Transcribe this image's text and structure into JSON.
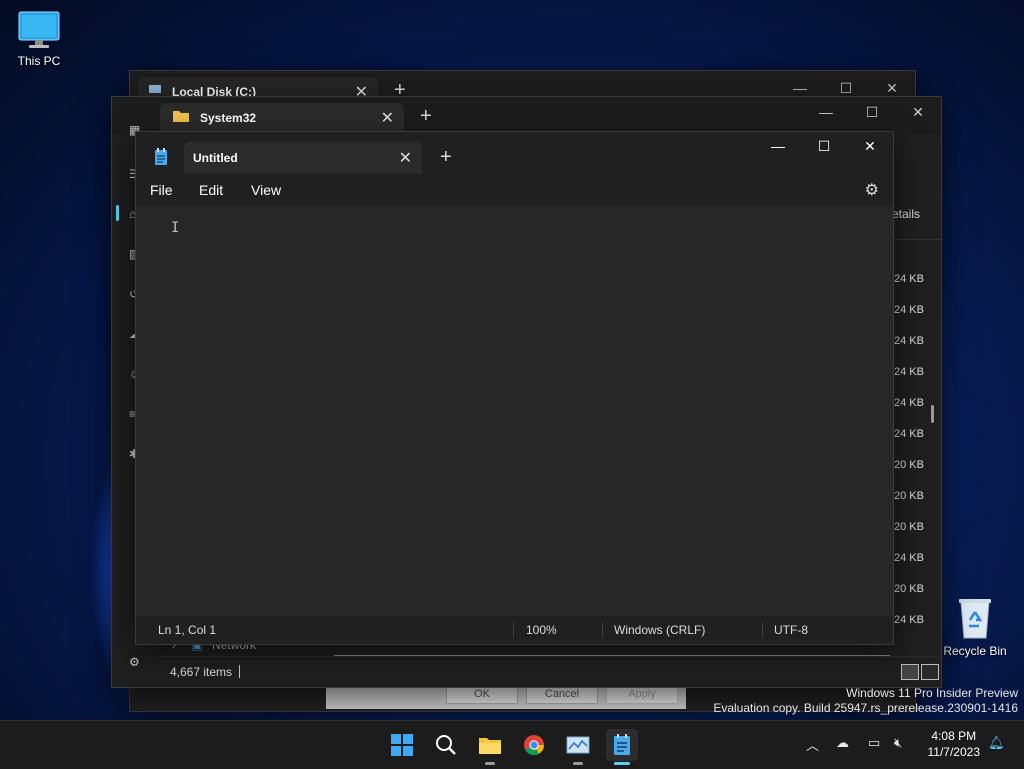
{
  "desktop": {
    "this_pc_label": "This PC",
    "recycle_bin_label": "Recycle Bin",
    "watermark_line1": "Windows 11 Pro Insider Preview",
    "watermark_line2": "Evaluation copy. Build 25947.rs_prerelease.230901-1416"
  },
  "explorer_back": {
    "tab_label": "Local Disk (C:)"
  },
  "explorer_front": {
    "tab_label": "System32",
    "details_label": "etails",
    "sizes": [
      "24 KB",
      "24 KB",
      "24 KB",
      "24 KB",
      "24 KB",
      "24 KB",
      "20 KB",
      "20 KB",
      "20 KB",
      "24 KB",
      "20 KB",
      "24 KB"
    ],
    "network_label": "Network",
    "items_count": "4,667 items",
    "dialog_ok": "OK",
    "dialog_cancel": "Cancel",
    "dialog_apply": "Apply"
  },
  "notepad": {
    "tab_label": "Untitled",
    "menu": {
      "file": "File",
      "edit": "Edit",
      "view": "View"
    },
    "status": {
      "position": "Ln 1, Col 1",
      "zoom": "100%",
      "line_endings": "Windows (CRLF)",
      "encoding": "UTF-8"
    }
  },
  "taskbar": {
    "apps": [
      "start-icon",
      "search-icon",
      "file-explorer-icon",
      "chrome-icon",
      "task-manager-icon",
      "notepad-icon"
    ],
    "time": "4:08 PM",
    "date": "11/7/2023"
  },
  "colors": {
    "accent": "#60cdff",
    "window_bg": "#202020",
    "editor_bg": "#272727"
  }
}
